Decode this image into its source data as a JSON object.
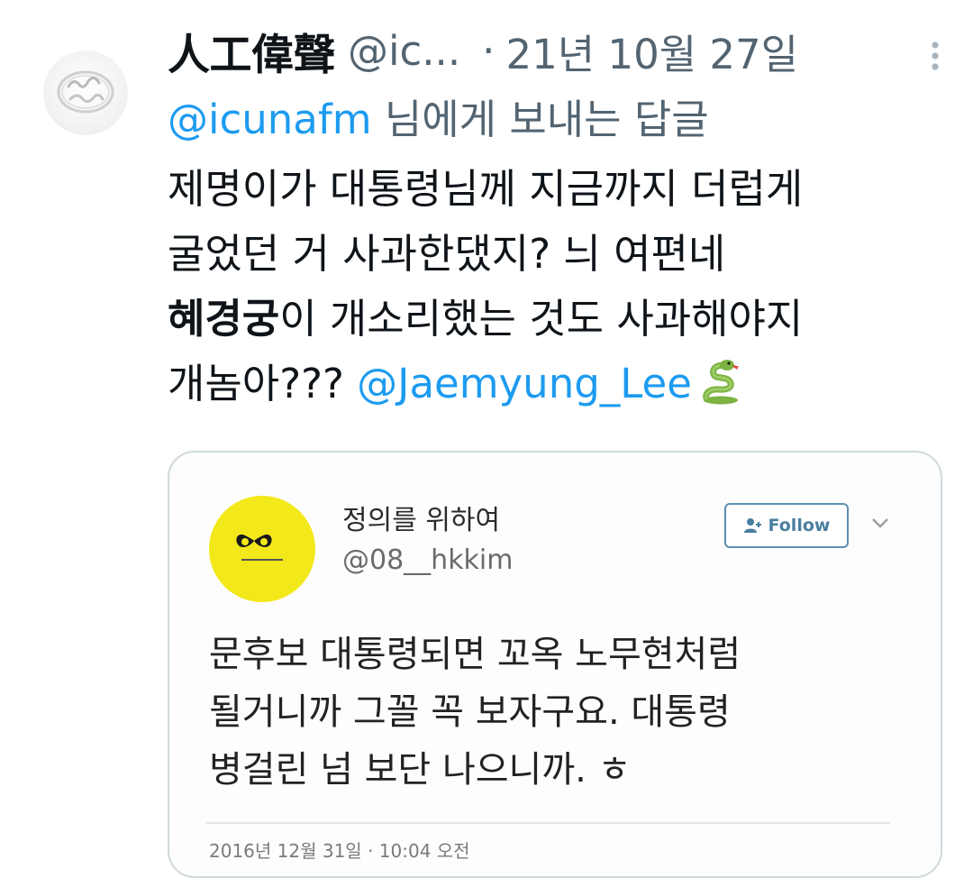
{
  "tweet": {
    "author_name": "人工偉聲",
    "author_handle": "@ic...",
    "separator": "·",
    "date": "21년 10월 27일",
    "reply_to_handle": "@icunafm",
    "reply_to_suffix": " 님에게 보내는 답글",
    "text": {
      "line1": "제명이가 대통령님께 지금까지 더럽게",
      "line2": "굴었던 거 사과한댔지? 늬 여편네",
      "line3_bold": "혜경궁",
      "line3_rest": "이 개소리했는 것도 사과해야지",
      "line4_pre": "개놈아??? ",
      "line4_mention": "@Jaemyung_Lee"
    },
    "emoji": "snake-icon",
    "avatar_icon": "ring-icon",
    "more_icon": "more-vertical-icon"
  },
  "quoted": {
    "name": "정의를 위하여",
    "handle": "@08__hkkim",
    "follow_label": "Follow",
    "text": {
      "line1": "문후보 대통령되면 꼬옥 노무현처럼",
      "line2": "될거니까 그꼴 꼭 보자구요. 대통령",
      "line3": "병걸린 넘 보단 나으니까. ㅎ"
    },
    "timestamp": "2016년 12월 31일 · 10:04 오전",
    "avatar_icon": "yellow-logo-avatar",
    "follow_icon": "add-user-icon",
    "chevron_icon": "chevron-down-icon"
  },
  "colors": {
    "text": "#0f1419",
    "secondary": "#536471",
    "link": "#1d9bf0",
    "quote_border": "#cfd9de",
    "quoted_avatar": "#f3e81a"
  }
}
